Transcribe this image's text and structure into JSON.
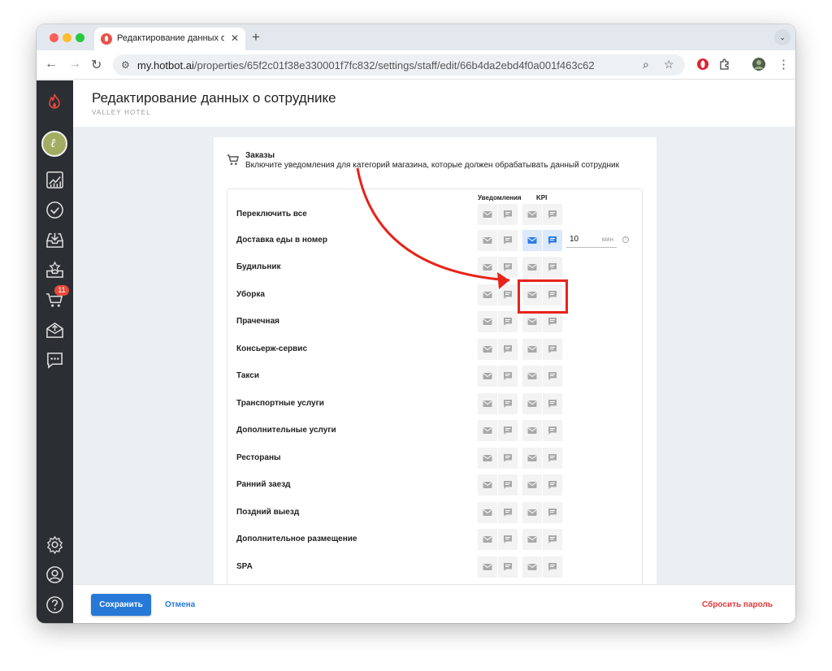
{
  "browser": {
    "tab_title": "Редактирование данных о сотруднике",
    "tab_close": "✕",
    "new_tab": "+",
    "tab_menu": "⌄",
    "url_host": "my.hotbot.ai",
    "url_path": "/properties/65f2c01f38e330001f7fc832/settings/staff/edit/66b4da2ebd4f0a001f463c62",
    "back": "←",
    "forward": "→",
    "reload": "↻",
    "site_info": "⚙",
    "zoom_icon": "⌕",
    "bookmark_icon": "☆",
    "menu_icon": "⋮"
  },
  "sidebar": {
    "orders_badge": "11"
  },
  "header": {
    "title": "Редактирование данных о сотруднике",
    "subtitle": "VALLEY HOTEL"
  },
  "section": {
    "title": "Заказы",
    "description": "Включите уведомления для категорий магазина, которые должен обрабатывать данный сотрудник"
  },
  "table": {
    "col_notifications": "Уведомления",
    "col_kpi": "KPI",
    "toggle_all": "Переключить все",
    "kpi_value": "10",
    "kpi_unit": "мин",
    "kpi_info": "?",
    "rows": [
      {
        "label": "Доставка еды в номер"
      },
      {
        "label": "Будильник"
      },
      {
        "label": "Уборка"
      },
      {
        "label": "Прачечная"
      },
      {
        "label": "Консьерж-сервис"
      },
      {
        "label": "Такси"
      },
      {
        "label": "Транспортные услуги"
      },
      {
        "label": "Дополнительные услуги"
      },
      {
        "label": "Рестораны"
      },
      {
        "label": "Ранний заезд"
      },
      {
        "label": "Поздний выезд"
      },
      {
        "label": "Дополнительное размещение"
      },
      {
        "label": "SPA"
      }
    ]
  },
  "footer": {
    "save": "Сохранить",
    "cancel": "Отмена",
    "reset_password": "Сбросить пароль"
  },
  "colors": {
    "accent": "#2779d8",
    "danger": "#e5393b",
    "annotation": "#e8231a",
    "active_icon": "#2f7de1",
    "inactive_icon": "#a9a9a9"
  }
}
